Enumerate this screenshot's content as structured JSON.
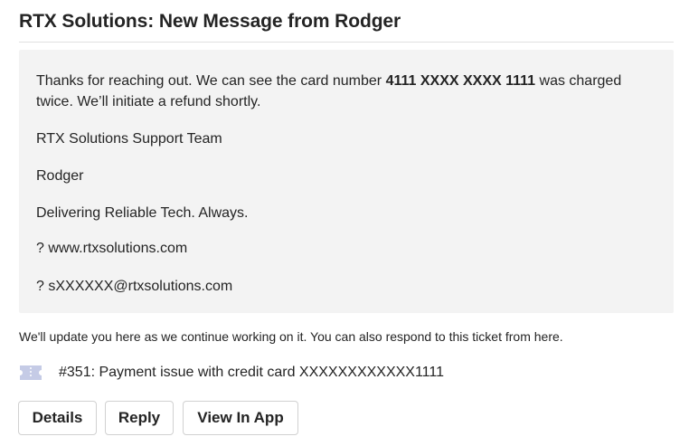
{
  "header": {
    "title": "RTX Solutions: New Message from Rodger"
  },
  "message": {
    "intro_before": "Thanks for reaching out. We can see the card number ",
    "card_number": "4111 XXXX XXXX 1111",
    "intro_after": " was charged twice. We’ll initiate a refund shortly.",
    "team": "RTX Solutions Support Team",
    "sender": "Rodger",
    "tagline": "Delivering Reliable Tech. Always.",
    "website": "? www.rtxsolutions.com",
    "email": "? sXXXXXX@rtxsolutions.com"
  },
  "note": "We'll update you here as we continue working on it. You can also respond to this ticket from here.",
  "ticket": {
    "icon": "ticket-icon",
    "text": "#351: Payment issue with credit card XXXXXXXXXXXX1111"
  },
  "actions": {
    "details": "Details",
    "reply": "Reply",
    "view_in_app": "View In App"
  },
  "colors": {
    "message_bg": "#f3f3f3",
    "ticket_icon": "#c5cbe6",
    "button_border": "#d1d1d1"
  }
}
